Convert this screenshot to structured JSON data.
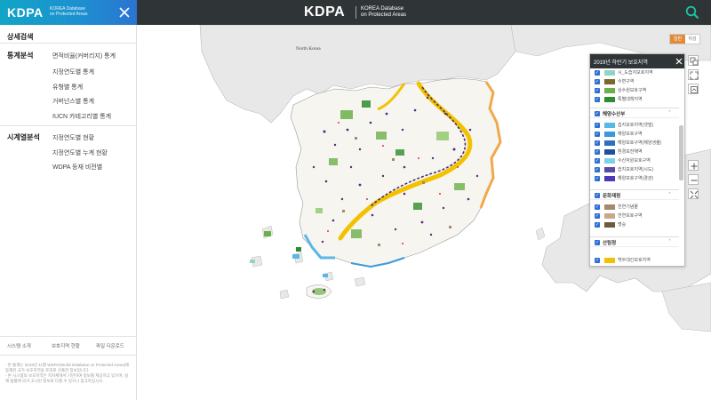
{
  "header": {
    "brand_logo": "KDPA",
    "brand_sub_line1": "KOREA Database",
    "brand_sub_line2": "on Protected Areas",
    "center_logo": "KDPA",
    "center_sub_line1": "KOREA Database",
    "center_sub_line2": "on Protected Areas",
    "close_icon": "close-icon",
    "search_icon": "search-icon",
    "accent_gradient": [
      "#12a5c6",
      "#2b74d0"
    ],
    "bar_color": "#2f3436"
  },
  "sidebar": {
    "title": "상세검색",
    "sections": [
      {
        "title": "통계분석",
        "items": [
          "면적비율(커버리지) 통계",
          "지정연도별 통계",
          "유형별 통계",
          "거버넌스별 통계",
          "IUCN 카테고리별 통계"
        ]
      },
      {
        "title": "시계열분석",
        "items": [
          "지정연도별 현황",
          "지정연도별 누계 현황",
          "WDPA 등재 비전별"
        ]
      }
    ],
    "footer_links": [
      "시스템 소개",
      "보호지역 현황",
      "파일 다운로드"
    ],
    "footer_notes": [
      "- 본 통계는 2019년 11월 WDPA(World Database on Protected Areas)에 등재된 국가 보호지역을 토대로 산출한 정보입니다.",
      "- 본 시스템의 보호지역은 지자체에서 기반하여 정보를 제공하고 있으며, 실제 법률에 의거 고시된 정보와 다를 수 있으니 참고하십시오."
    ]
  },
  "map": {
    "north_korea_label": "North Korea",
    "maptype_normal": "일반",
    "maptype_satellite": "위성",
    "maptype_active_color": "#e08a3a"
  },
  "legend": {
    "title": "2019년 하반기 보호지역",
    "close_icon": "close-icon",
    "groups": [
      {
        "title": "",
        "items": [
          {
            "label": "시_도습지보호지역",
            "color": "#8fd3c9"
          },
          {
            "label": "수변구역",
            "color": "#7a6a2a"
          },
          {
            "label": "상수원보호구역",
            "color": "#6bb04a"
          },
          {
            "label": "특별대책지역",
            "color": "#2e8b2e"
          }
        ]
      },
      {
        "title": "해양수산부",
        "items": [
          {
            "label": "습지보호지역(갯벌)",
            "color": "#5ab8e6"
          },
          {
            "label": "해양보호구역",
            "color": "#3a9ad9"
          },
          {
            "label": "해양보호구역(해양생물)",
            "color": "#2f6fc0"
          },
          {
            "label": "환경보전해역",
            "color": "#1f4fa0"
          },
          {
            "label": "수산자원보호구역",
            "color": "#7ad3e6"
          },
          {
            "label": "습지보호지역(시도)",
            "color": "#5a4aa8"
          },
          {
            "label": "해양보호구역(경관)",
            "color": "#4a3ab8"
          }
        ]
      },
      {
        "title": "문화재청",
        "items": [
          {
            "label": "천연기념물",
            "color": "#a6896a"
          },
          {
            "label": "천연보호구역",
            "color": "#c7a98a"
          },
          {
            "label": "명승",
            "color": "#6e5a3e"
          }
        ]
      },
      {
        "title": "산림청",
        "items": [
          {
            "label": "백두대간보호지역",
            "color": "#f2c200"
          }
        ]
      }
    ]
  },
  "tools": [
    "layers-icon",
    "fullscreen-icon",
    "print-icon",
    "zoom-in-icon",
    "zoom-out-icon",
    "extent-icon"
  ]
}
